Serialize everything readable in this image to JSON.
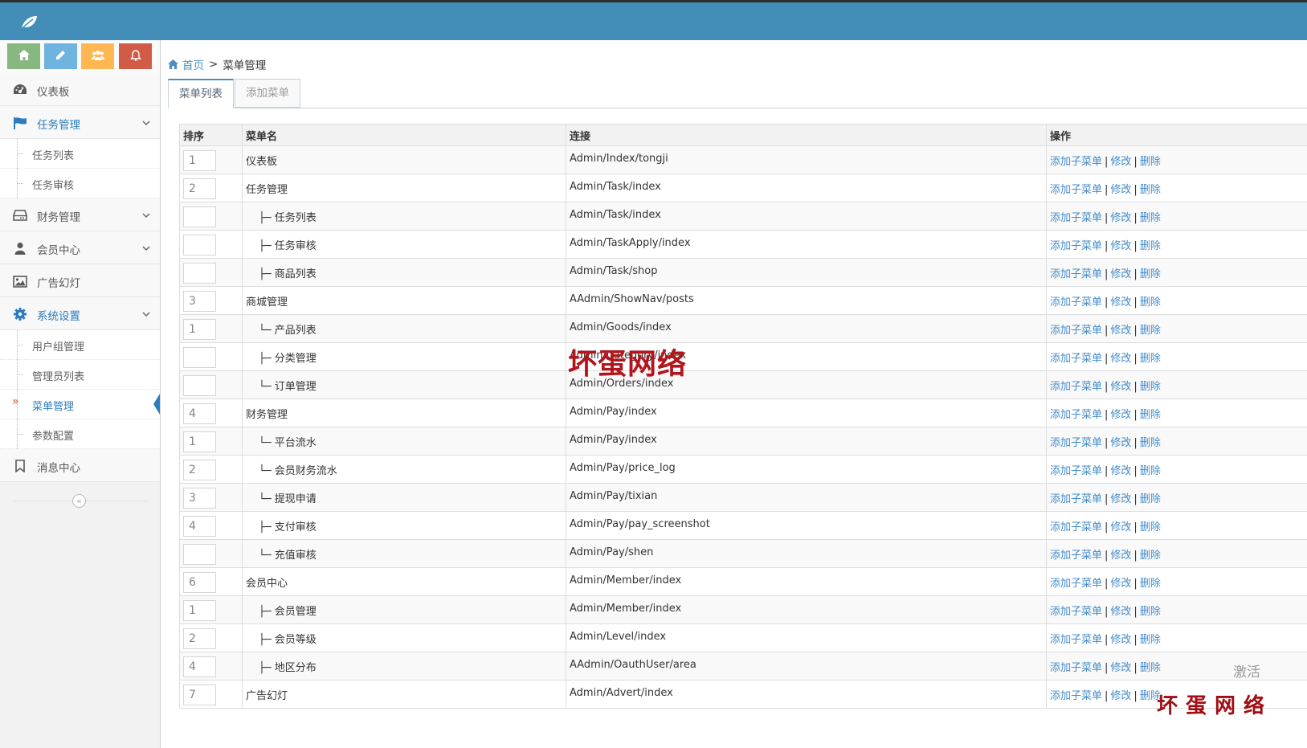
{
  "colors": {
    "topbar": "#438eb9",
    "link": "#428bca",
    "active": "#2b7dbc",
    "watermark": "#b3151c"
  },
  "header": {
    "logo_icon": "leaf-icon"
  },
  "shortcuts": [
    {
      "icon": "home-icon",
      "color": "#87b87f"
    },
    {
      "icon": "pencil-icon",
      "color": "#6fb3e0"
    },
    {
      "icon": "users-icon",
      "color": "#ffb752"
    },
    {
      "icon": "bell-icon",
      "color": "#d15b47"
    }
  ],
  "sidebar": {
    "dashboard": "仪表板",
    "task": "任务管理",
    "task_list": "任务列表",
    "task_review": "任务审核",
    "finance": "财务管理",
    "member": "会员中心",
    "ads": "广告幻灯",
    "system": "系统设置",
    "user_group": "用户组管理",
    "admin_list": "管理员列表",
    "menu_mgmt": "菜单管理",
    "params": "参数配置",
    "messages": "消息中心"
  },
  "breadcrumb": {
    "home": "首页",
    "sep": ">",
    "current": "菜单管理"
  },
  "tabs": {
    "list": "菜单列表",
    "add": "添加菜单"
  },
  "table": {
    "headers": {
      "sort": "排序",
      "name": "菜单名",
      "link": "连接",
      "ops": "操作"
    },
    "actions": {
      "add_child": "添加子菜单",
      "edit": "修改",
      "delete": "删除",
      "sep": "|"
    },
    "rows": [
      {
        "sort": "1",
        "name": "仪表板",
        "sub": false,
        "link": "Admin/Index/tongji"
      },
      {
        "sort": "2",
        "name": "任务管理",
        "sub": false,
        "link": "Admin/Task/index"
      },
      {
        "sort": "",
        "name": "├─ 任务列表",
        "sub": true,
        "link": "Admin/Task/index"
      },
      {
        "sort": "",
        "name": "├─ 任务审核",
        "sub": true,
        "link": "Admin/TaskApply/index"
      },
      {
        "sort": "",
        "name": "├─ 商品列表",
        "sub": true,
        "link": "Admin/Task/shop"
      },
      {
        "sort": "3",
        "name": "商城管理",
        "sub": false,
        "link": "AAdmin/ShowNav/posts"
      },
      {
        "sort": "1",
        "name": "└─ 产品列表",
        "sub": true,
        "link": "Admin/Goods/index"
      },
      {
        "sort": "",
        "name": "├─ 分类管理",
        "sub": true,
        "link": "Admin/Category/index"
      },
      {
        "sort": "",
        "name": "└─ 订单管理",
        "sub": true,
        "link": "Admin/Orders/index"
      },
      {
        "sort": "4",
        "name": "财务管理",
        "sub": false,
        "link": "Admin/Pay/index"
      },
      {
        "sort": "1",
        "name": "└─ 平台流水",
        "sub": true,
        "link": "Admin/Pay/index"
      },
      {
        "sort": "2",
        "name": "└─ 会员财务流水",
        "sub": true,
        "link": "Admin/Pay/price_log"
      },
      {
        "sort": "3",
        "name": "└─ 提现申请",
        "sub": true,
        "link": "Admin/Pay/tixian"
      },
      {
        "sort": "4",
        "name": "├─ 支付审核",
        "sub": true,
        "link": "Admin/Pay/pay_screenshot"
      },
      {
        "sort": "",
        "name": "└─ 充值审核",
        "sub": true,
        "link": "Admin/Pay/shen"
      },
      {
        "sort": "6",
        "name": "会员中心",
        "sub": false,
        "link": "Admin/Member/index"
      },
      {
        "sort": "1",
        "name": "├─ 会员管理",
        "sub": true,
        "link": "Admin/Member/index"
      },
      {
        "sort": "2",
        "name": "├─ 会员等级",
        "sub": true,
        "link": "Admin/Level/index"
      },
      {
        "sort": "4",
        "name": "├─ 地区分布",
        "sub": true,
        "link": "AAdmin/OauthUser/area"
      },
      {
        "sort": "7",
        "name": "广告幻灯",
        "sub": false,
        "link": "Admin/Advert/index"
      }
    ]
  },
  "watermark": {
    "main": "坏蛋网络",
    "corner": "坏蛋网络",
    "activate": "激活"
  }
}
